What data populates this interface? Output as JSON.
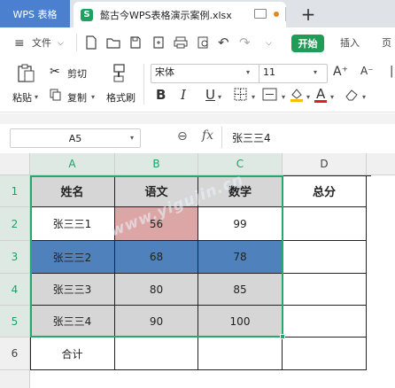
{
  "tabs": {
    "app": "WPS 表格",
    "document": "懿古今WPS表格演示案例.xlsx",
    "doc_icon_letter": "S",
    "new_tab": "+"
  },
  "menu": {
    "file": "文件",
    "start": "开始",
    "insert": "插入",
    "page": "页"
  },
  "ribbon": {
    "paste": "粘贴",
    "cut": "剪切",
    "copy": "复制",
    "format_painter": "格式刷",
    "font_name": "宋体",
    "font_size": "11",
    "bold": "B",
    "italic": "I",
    "underline": "U",
    "font_color_letter": "A"
  },
  "formula_bar": {
    "cell_ref": "A5",
    "fx": "fx",
    "value": "张三三4"
  },
  "columns": [
    "A",
    "B",
    "C",
    "D"
  ],
  "rows": [
    "1",
    "2",
    "3",
    "4",
    "5",
    "6"
  ],
  "table": {
    "header": [
      "姓名",
      "语文",
      "数学",
      "总分"
    ],
    "r2": [
      "张三三1",
      "56",
      "99",
      ""
    ],
    "r3": [
      "张三三2",
      "68",
      "78",
      ""
    ],
    "r4": [
      "张三三3",
      "80",
      "85",
      ""
    ],
    "r5": [
      "张三三4",
      "90",
      "100",
      ""
    ],
    "r6": [
      "合计",
      "",
      "",
      ""
    ]
  },
  "watermark": "www.yigujin.cn",
  "colors": {
    "accent_green": "#1f9d57",
    "highlight_blue": "#4f81bd",
    "highlight_pink": "#dca6a6",
    "cell_gray": "#d6d6d6"
  }
}
